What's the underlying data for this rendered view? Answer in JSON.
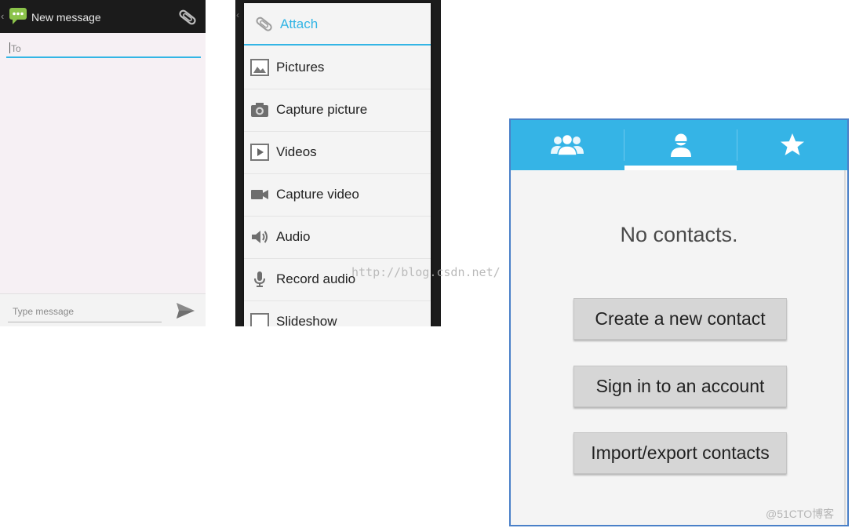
{
  "new_message_screen": {
    "title": "New message",
    "back_glyph": "‹",
    "to_placeholder": "To",
    "type_placeholder": "Type message",
    "icons": [
      "message-app-icon",
      "paperclip-icon",
      "send-icon"
    ],
    "accent_color": "#33b5e5"
  },
  "attach_menu": {
    "title": "Attach",
    "items": [
      {
        "label": "Pictures",
        "icon": "picture-icon"
      },
      {
        "label": "Capture picture",
        "icon": "camera-icon"
      },
      {
        "label": "Videos",
        "icon": "video-icon"
      },
      {
        "label": "Capture video",
        "icon": "video-camera-icon"
      },
      {
        "label": "Audio",
        "icon": "speaker-icon"
      },
      {
        "label": "Record audio",
        "icon": "microphone-icon"
      },
      {
        "label": "Slideshow",
        "icon": "slideshow-icon"
      }
    ],
    "accent_color": "#33b5e5"
  },
  "watermark": "http://blog.csdn.net/",
  "contacts_screen": {
    "tabs": [
      {
        "icon": "groups-icon",
        "selected": false
      },
      {
        "icon": "person-icon",
        "selected": true
      },
      {
        "icon": "star-icon",
        "selected": false
      }
    ],
    "empty_text": "No contacts.",
    "buttons": {
      "create": "Create a new contact",
      "sign_in": "Sign in to an account",
      "import_export": "Import/export contacts"
    },
    "tab_color": "#35b4e6"
  },
  "credit": "@51CTO博客"
}
